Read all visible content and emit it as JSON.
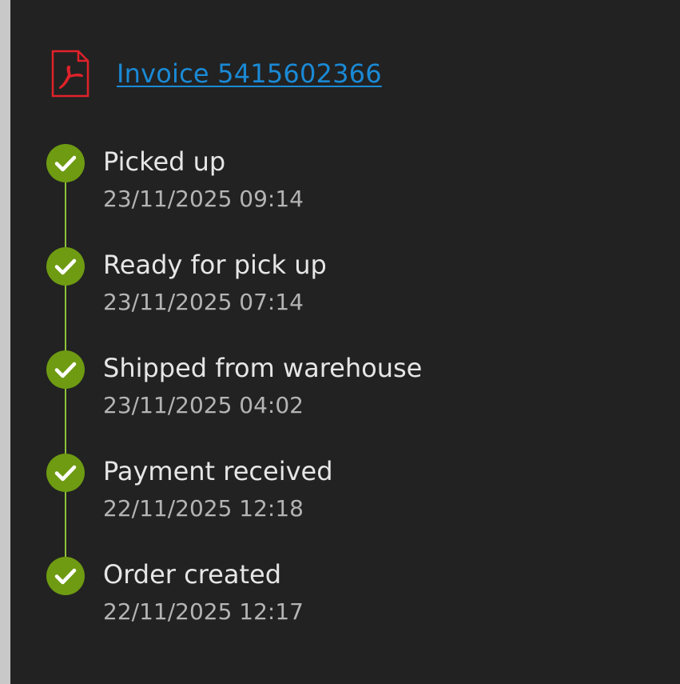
{
  "invoice": {
    "icon": "pdf-icon",
    "link_text": "Invoice 5415602366"
  },
  "timeline": {
    "icon": "check-circle-icon",
    "colors": {
      "check_fill": "#6e9b12",
      "line": "#8fc23a",
      "link": "#1a8ad6"
    },
    "events": [
      {
        "title": "Picked up",
        "time": "23/11/2025 09:14"
      },
      {
        "title": "Ready for pick up",
        "time": "23/11/2025 07:14"
      },
      {
        "title": "Shipped from warehouse",
        "time": "23/11/2025 04:02"
      },
      {
        "title": "Payment received",
        "time": "22/11/2025 12:18"
      },
      {
        "title": "Order created",
        "time": "22/11/2025 12:17"
      }
    ]
  }
}
